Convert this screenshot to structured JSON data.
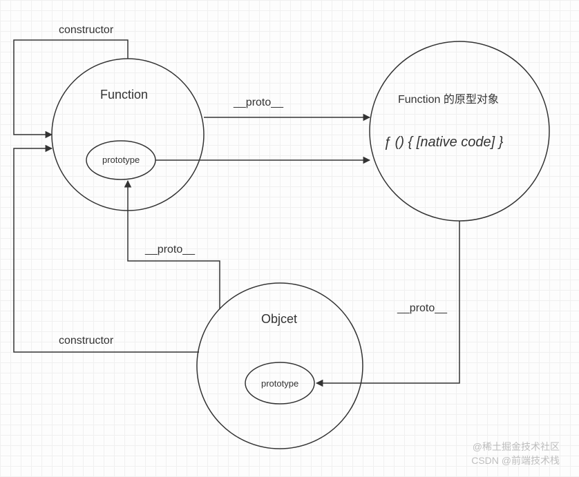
{
  "nodes": {
    "function": {
      "label": "Function",
      "inner": "prototype"
    },
    "object": {
      "label": "Objcet",
      "inner": "prototype"
    },
    "functionProto": {
      "label1": "Function 的原型对象",
      "label2": "ƒ () { [native code] }"
    }
  },
  "edges": {
    "constructorTop": "constructor",
    "protoFuncToProto": "__proto__",
    "constructorBottom": "constructor",
    "protoObjToFunc": "__proto__",
    "protoFuncProtoToObj": "__proto__"
  },
  "watermarks": {
    "w1": "@稀土掘金技术社区",
    "w2": "CSDN @前端技术栈"
  }
}
